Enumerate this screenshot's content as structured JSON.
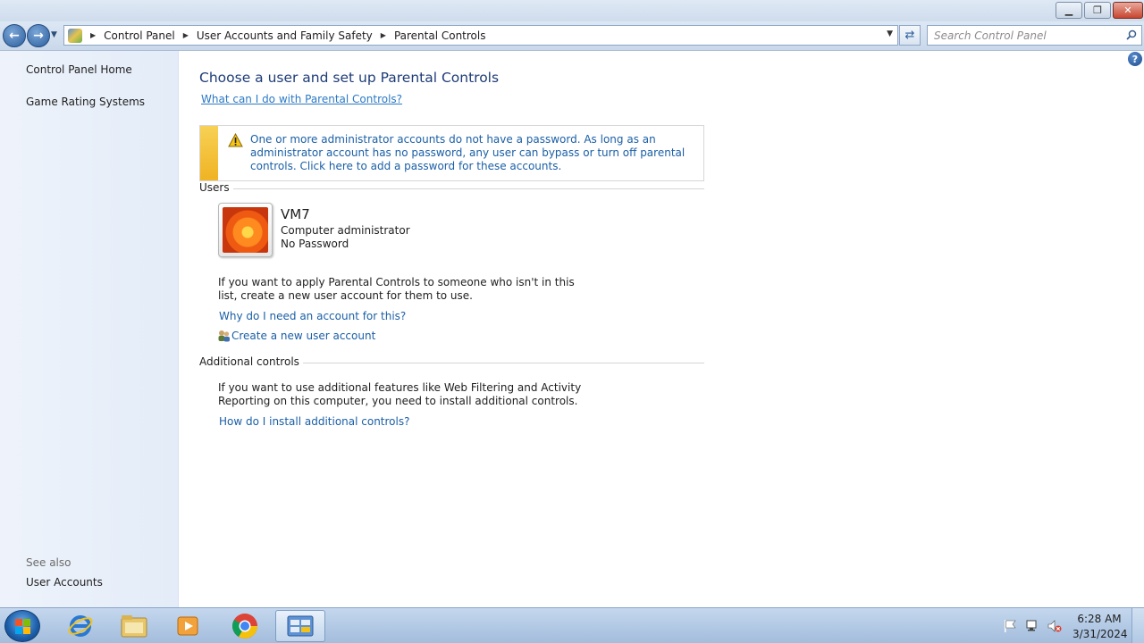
{
  "window": {
    "controls": [
      "minimize",
      "maximize",
      "close"
    ]
  },
  "address_bar": {
    "breadcrumbs": [
      "Control Panel",
      "User Accounts and Family Safety",
      "Parental Controls"
    ]
  },
  "search": {
    "placeholder": "Search Control Panel"
  },
  "left_pane": {
    "links": [
      "Control Panel Home",
      "Game Rating Systems"
    ],
    "see_also_label": "See also",
    "see_also_links": [
      "User Accounts"
    ]
  },
  "main": {
    "title": "Choose a user and set up Parental Controls",
    "help_link": "What can I do with Parental Controls?",
    "warning": "One or more administrator accounts do not have a password. As long as an administrator account has no password, any user can bypass or turn off parental controls. Click here to add a password for these accounts.",
    "users_section": "Users",
    "user": {
      "name": "VM7",
      "role": "Computer administrator",
      "password_status": "No Password"
    },
    "apply_text": "If you want to apply Parental Controls to someone who isn't in this list, create a new user account for them to use.",
    "why_link": "Why do I need an account for this?",
    "create_link": "Create a new user account",
    "additional_section": "Additional controls",
    "additional_text": "If you want to use additional features like Web Filtering and Activity Reporting on this computer, you need to install additional controls.",
    "install_link": "How do I install additional controls?"
  },
  "taskbar": {
    "items": [
      "internet-explorer-icon",
      "windows-explorer-icon",
      "media-player-icon",
      "chrome-icon",
      "control-panel-icon"
    ],
    "time": "6:28 AM",
    "date": "3/31/2024"
  },
  "colors": {
    "link": "#1a5fa6",
    "title": "#1e3c78",
    "warning_stripe": "#f0b323"
  }
}
